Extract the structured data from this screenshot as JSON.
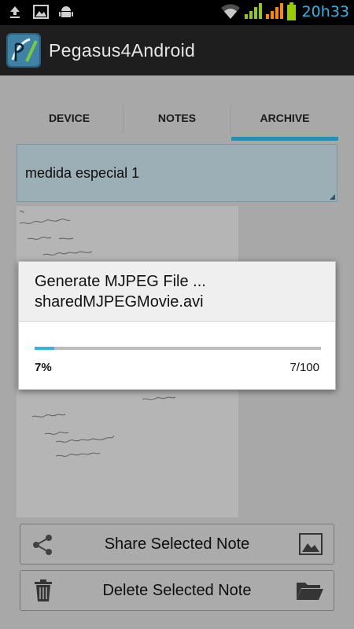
{
  "status_bar": {
    "time": "20h33",
    "icons": [
      "upload-icon",
      "image-icon",
      "android-icon",
      "wifi-icon",
      "signal-icon",
      "signal-icon",
      "battery-icon"
    ]
  },
  "app": {
    "title": "Pegasus4Android"
  },
  "tabs": [
    {
      "label": "DEVICE",
      "selected": false
    },
    {
      "label": "NOTES",
      "selected": false
    },
    {
      "label": "ARCHIVE",
      "selected": true
    }
  ],
  "note": {
    "title": "medida especial 1"
  },
  "buttons": {
    "share_label": "Share Selected Note",
    "delete_label": "Delete Selected Note"
  },
  "dialog": {
    "title_line1": "Generate MJPEG File ...",
    "title_line2": "sharedMJPEGMovie.avi",
    "progress_fraction": 0.07,
    "percent_label": "7%",
    "count_label": "7/100"
  },
  "colors": {
    "accent": "#33b5e5",
    "note_field": "#c8dfe9",
    "signal_green": "#99cc00",
    "signal_orange": "#ff8800"
  }
}
